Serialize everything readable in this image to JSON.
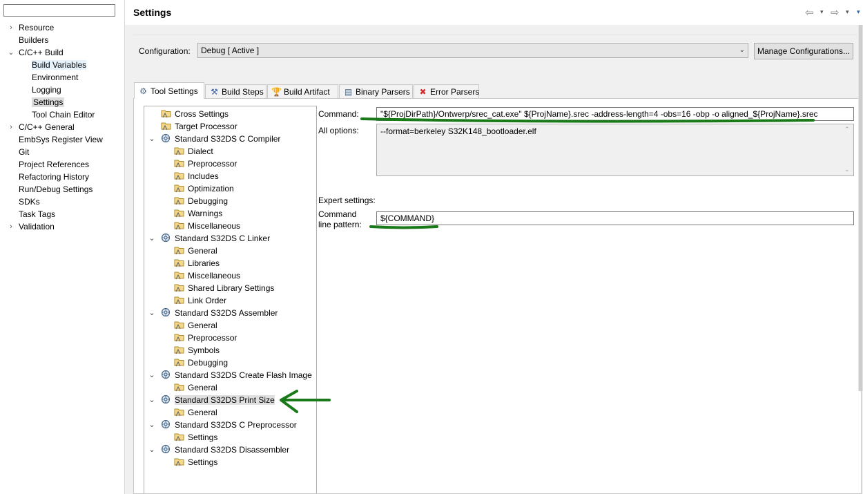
{
  "nav": {
    "filter_value": "",
    "items": [
      {
        "label": "Resource",
        "chevron": "›"
      },
      {
        "label": "Builders",
        "chevron": ""
      },
      {
        "label": "C/C++ Build",
        "chevron": "⌄"
      },
      {
        "label": "Build Variables",
        "chevron": ""
      },
      {
        "label": "Environment",
        "chevron": ""
      },
      {
        "label": "Logging",
        "chevron": ""
      },
      {
        "label": "Settings",
        "chevron": ""
      },
      {
        "label": "Tool Chain Editor",
        "chevron": ""
      },
      {
        "label": "C/C++ General",
        "chevron": "›"
      },
      {
        "label": "EmbSys Register View",
        "chevron": ""
      },
      {
        "label": "Git",
        "chevron": ""
      },
      {
        "label": "Project References",
        "chevron": ""
      },
      {
        "label": "Refactoring History",
        "chevron": ""
      },
      {
        "label": "Run/Debug Settings",
        "chevron": ""
      },
      {
        "label": "SDKs",
        "chevron": ""
      },
      {
        "label": "Task Tags",
        "chevron": ""
      },
      {
        "label": "Validation",
        "chevron": "›"
      }
    ]
  },
  "header": {
    "title": "Settings",
    "back_icon": "⇦",
    "forward_icon": "⇨",
    "dropdown_icon": "▾"
  },
  "config": {
    "label": "Configuration:",
    "value": "Debug  [ Active ]",
    "arrow": "⌄",
    "manage_button": "Manage Configurations..."
  },
  "tabs": [
    {
      "label": "Tool Settings",
      "icon": "⚙"
    },
    {
      "label": "Build Steps",
      "icon": "⚒"
    },
    {
      "label": "Build Artifact",
      "icon": "🏆"
    },
    {
      "label": "Binary Parsers",
      "icon": "▤"
    },
    {
      "label": "Error Parsers",
      "icon": "✖"
    }
  ],
  "tree": [
    {
      "label": "Cross Settings",
      "chevron": ""
    },
    {
      "label": "Target Processor",
      "chevron": ""
    },
    {
      "label": "Standard S32DS C Compiler",
      "chevron": "⌄"
    },
    {
      "label": "Dialect",
      "chevron": ""
    },
    {
      "label": "Preprocessor",
      "chevron": ""
    },
    {
      "label": "Includes",
      "chevron": ""
    },
    {
      "label": "Optimization",
      "chevron": ""
    },
    {
      "label": "Debugging",
      "chevron": ""
    },
    {
      "label": "Warnings",
      "chevron": ""
    },
    {
      "label": "Miscellaneous",
      "chevron": ""
    },
    {
      "label": "Standard S32DS C Linker",
      "chevron": "⌄"
    },
    {
      "label": "General",
      "chevron": ""
    },
    {
      "label": "Libraries",
      "chevron": ""
    },
    {
      "label": "Miscellaneous",
      "chevron": ""
    },
    {
      "label": "Shared Library Settings",
      "chevron": ""
    },
    {
      "label": "Link Order",
      "chevron": ""
    },
    {
      "label": "Standard S32DS Assembler",
      "chevron": "⌄"
    },
    {
      "label": "General",
      "chevron": ""
    },
    {
      "label": "Preprocessor",
      "chevron": ""
    },
    {
      "label": "Symbols",
      "chevron": ""
    },
    {
      "label": "Debugging",
      "chevron": ""
    },
    {
      "label": "Standard S32DS Create Flash Image",
      "chevron": "⌄"
    },
    {
      "label": "General",
      "chevron": ""
    },
    {
      "label": "Standard S32DS Print Size",
      "chevron": "⌄"
    },
    {
      "label": "General",
      "chevron": ""
    },
    {
      "label": "Standard S32DS C Preprocessor",
      "chevron": "⌄"
    },
    {
      "label": "Settings",
      "chevron": ""
    },
    {
      "label": "Standard S32DS Disassembler",
      "chevron": "⌄"
    },
    {
      "label": "Settings",
      "chevron": ""
    }
  ],
  "options": {
    "command_label": "Command:",
    "command_value": "\"${ProjDirPath}/Ontwerp/srec_cat.exe\" ${ProjName}.srec -address-length=4 -obs=16 -obp -o aligned_${ProjName}.srec",
    "all_options_label": "All options:",
    "all_options_value": "--format=berkeley S32K148_bootloader.elf",
    "expert_label": "Expert settings:",
    "pattern_label_1": "Command",
    "pattern_label_2": "line pattern:",
    "pattern_value": "${COMMAND}"
  },
  "colors": {
    "annotation_green": "#1a7a1a",
    "selection": "#e5f1fb"
  }
}
